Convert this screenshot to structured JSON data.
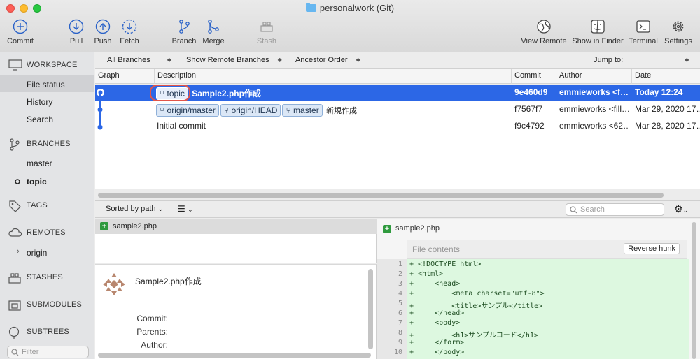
{
  "window": {
    "title": "personalwork (Git)"
  },
  "toolbar": {
    "commit": "Commit",
    "pull": "Pull",
    "push": "Push",
    "fetch": "Fetch",
    "branch": "Branch",
    "merge": "Merge",
    "stash": "Stash",
    "view_remote": "View Remote",
    "show_in_finder": "Show in Finder",
    "terminal": "Terminal",
    "settings": "Settings"
  },
  "sidebar": {
    "workspace": "WORKSPACE",
    "workspace_items": [
      "File status",
      "History",
      "Search"
    ],
    "branches": "BRANCHES",
    "branch_items": [
      "master",
      "topic"
    ],
    "tags": "TAGS",
    "remotes": "REMOTES",
    "remote_items": [
      "origin"
    ],
    "stashes": "STASHES",
    "submodules": "SUBMODULES",
    "subtrees": "SUBTREES",
    "filter_placeholder": "Filter"
  },
  "filters": {
    "branches": "All Branches",
    "remote_branches": "Show Remote Branches",
    "order": "Ancestor Order",
    "jump_to": "Jump to:"
  },
  "columns": {
    "graph": "Graph",
    "description": "Description",
    "commit": "Commit",
    "author": "Author",
    "date": "Date"
  },
  "commits": [
    {
      "tags": [
        "topic"
      ],
      "message": "Sample2.php作成",
      "hash": "9e460d9",
      "author": "emmieworks <f…",
      "date": "Today 12:24"
    },
    {
      "tags": [
        "origin/master",
        "origin/HEAD",
        "master"
      ],
      "message": "新規作成",
      "hash": "f7567f7",
      "author": "emmieworks <fill…",
      "date": "Mar 29, 2020 17…"
    },
    {
      "tags": [],
      "message": "Initial commit",
      "hash": "f9c4792",
      "author": "emmieworks <62…",
      "date": "Mar 28, 2020 17…"
    }
  ],
  "lower": {
    "sort": "Sorted by path",
    "search_placeholder": "Search"
  },
  "files": [
    "sample2.php"
  ],
  "details": {
    "message": "Sample2.php作成",
    "commit_label": "Commit:",
    "parents_label": "Parents:",
    "author_label": "Author:"
  },
  "diff": {
    "file": "sample2.php",
    "file_contents": "File contents",
    "reverse_hunk": "Reverse hunk",
    "lines": [
      {
        "n": "1",
        "text": "+ <!DOCTYPE html>"
      },
      {
        "n": "2",
        "text": "+ <html>"
      },
      {
        "n": "3",
        "text": "+     <head>"
      },
      {
        "n": "4",
        "text": "+         <meta charset=\"utf-8\">"
      },
      {
        "n": "5",
        "text": "+         <title>サンプル</title>"
      },
      {
        "n": "6",
        "text": "+     </head>"
      },
      {
        "n": "7",
        "text": "+     <body>"
      },
      {
        "n": "8",
        "text": "+         <h1>サンプルコード</h1>"
      },
      {
        "n": "9",
        "text": "+     </form>"
      },
      {
        "n": "10",
        "text": "+     </body>"
      }
    ]
  },
  "colors": {
    "selection": "#2c67e6",
    "add_bg": "#ddf8e0",
    "ring": "#e2554a"
  }
}
